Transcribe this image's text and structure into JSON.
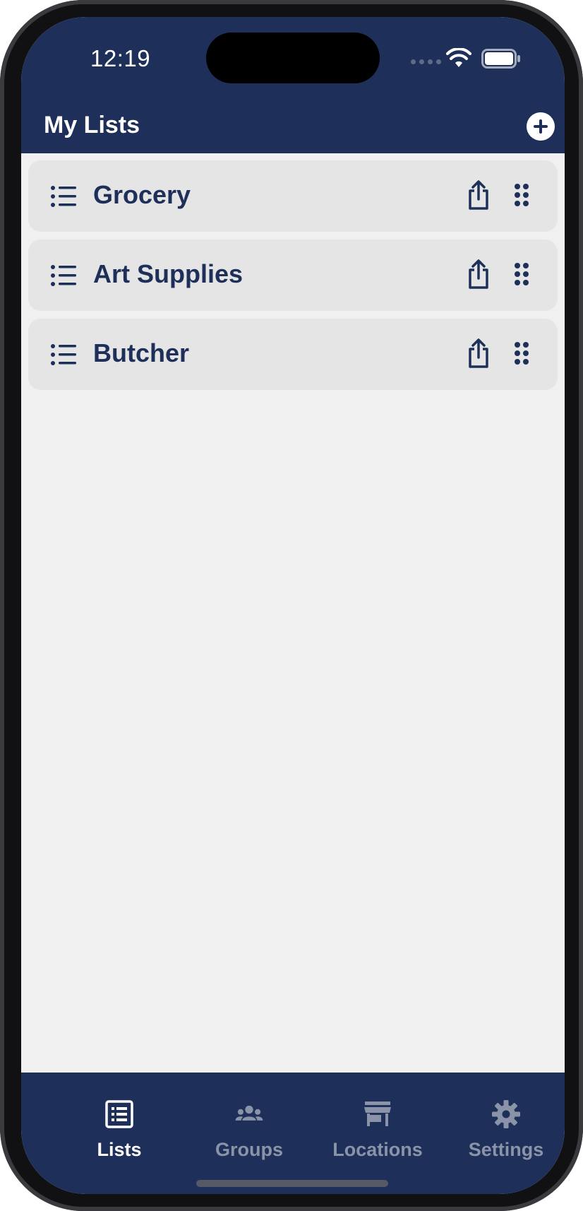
{
  "status_bar": {
    "time": "12:19"
  },
  "header": {
    "title": "My Lists",
    "add_icon": "plus-circle-icon"
  },
  "lists": [
    {
      "name": "Grocery",
      "icon": "list-bullet-icon"
    },
    {
      "name": "Art Supplies",
      "icon": "list-bullet-icon"
    },
    {
      "name": "Butcher",
      "icon": "list-bullet-icon"
    }
  ],
  "tabs": [
    {
      "label": "Lists",
      "icon": "list-alt-icon",
      "active": true
    },
    {
      "label": "Groups",
      "icon": "users-icon",
      "active": false
    },
    {
      "label": "Locations",
      "icon": "store-icon",
      "active": false
    },
    {
      "label": "Settings",
      "icon": "gear-icon",
      "active": false
    }
  ],
  "colors": {
    "primary": "#1e3059",
    "background": "#f0f0f0",
    "card": "#e5e5e5",
    "tab_inactive": "#8a93a8",
    "tab_active": "#ffffff"
  }
}
